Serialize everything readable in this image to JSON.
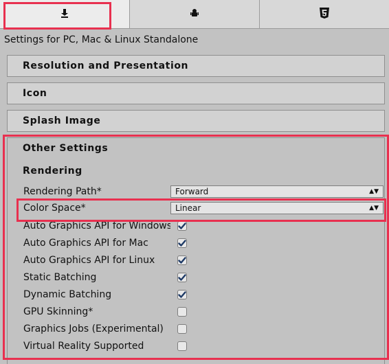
{
  "tabs": [
    {
      "icon": "download-icon",
      "glyph": "⬇",
      "active": true
    },
    {
      "icon": "android-icon",
      "glyph": "🤖",
      "active": false
    },
    {
      "icon": "html5-icon",
      "glyph": "5",
      "active": false
    }
  ],
  "platform_title": "Settings for PC, Mac & Linux Standalone",
  "sections": {
    "resolution": "Resolution and Presentation",
    "icon": "Icon",
    "splash": "Splash Image",
    "other": "Other Settings"
  },
  "rendering": {
    "heading": "Rendering",
    "rendering_path_label": "Rendering Path*",
    "rendering_path_value": "Forward",
    "color_space_label": "Color Space*",
    "color_space_value": "Linear",
    "toggles": [
      {
        "label": "Auto Graphics API for Windows",
        "checked": true
      },
      {
        "label": "Auto Graphics API for Mac",
        "checked": true
      },
      {
        "label": "Auto Graphics API for Linux",
        "checked": true
      },
      {
        "label": "Static Batching",
        "checked": true
      },
      {
        "label": "Dynamic Batching",
        "checked": true
      },
      {
        "label": "GPU Skinning*",
        "checked": false
      },
      {
        "label": "Graphics Jobs (Experimental)",
        "checked": false
      },
      {
        "label": "Virtual Reality Supported",
        "checked": false
      }
    ]
  },
  "colors": {
    "highlight": "#e8304f",
    "checkmark": "#1e3a66"
  }
}
